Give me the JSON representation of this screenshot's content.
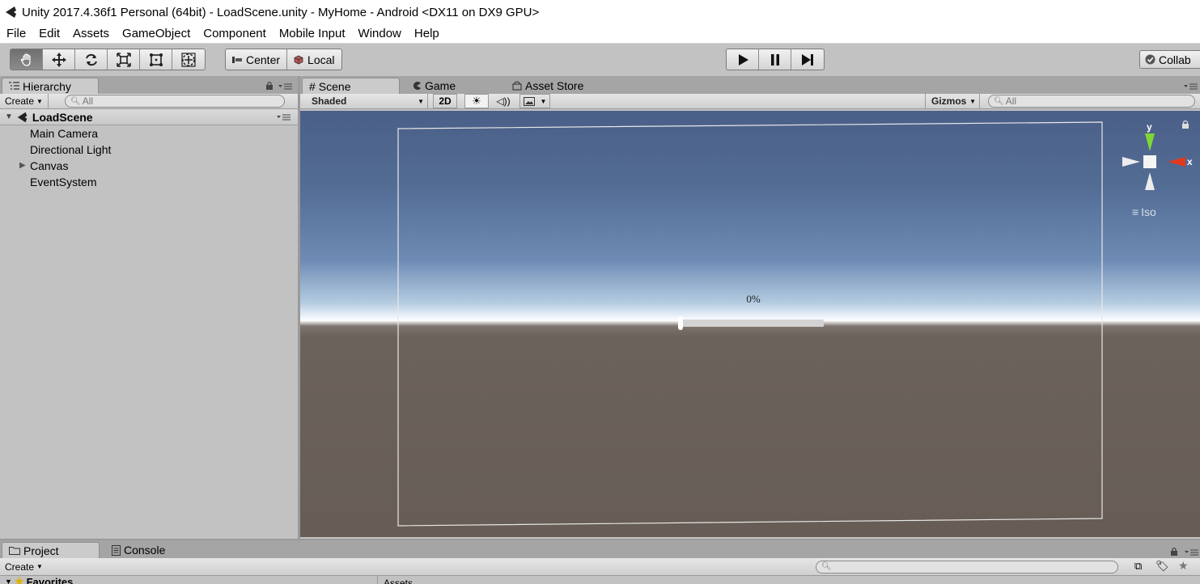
{
  "window": {
    "title": "Unity 2017.4.36f1 Personal (64bit) - LoadScene.unity - MyHome - Android <DX11 on DX9 GPU>"
  },
  "menu": {
    "items": [
      "File",
      "Edit",
      "Assets",
      "GameObject",
      "Component",
      "Mobile Input",
      "Window",
      "Help"
    ]
  },
  "toolbar": {
    "pivot_label": "Center",
    "space_label": "Local",
    "collab_label": "Collab"
  },
  "hierarchy": {
    "tab_label": "Hierarchy",
    "create_label": "Create",
    "search_placeholder": "All",
    "scene_name": "LoadScene",
    "items": [
      "Main Camera",
      "Directional Light",
      "Canvas",
      "EventSystem"
    ]
  },
  "scene": {
    "tabs": [
      "Scene",
      "Game",
      "Asset Store"
    ],
    "shading_mode": "Shaded",
    "mode_2d_label": "2D",
    "gizmos_label": "Gizmos",
    "search_placeholder": "All",
    "iso_label": "Iso",
    "axis_y": "y",
    "axis_x": "x",
    "progress_text": "0%",
    "progress_value": 0
  },
  "bottom": {
    "tabs": [
      "Project",
      "Console"
    ],
    "create_label": "Create",
    "favorites_label": "Favorites",
    "breadcrumb": "Assets"
  },
  "colors": {
    "panel_bg": "#c2c2c2",
    "sky_top": "#4a5f87",
    "ground": "#675c56",
    "axis_red": "#e03a1e",
    "axis_green": "#7fd634"
  }
}
